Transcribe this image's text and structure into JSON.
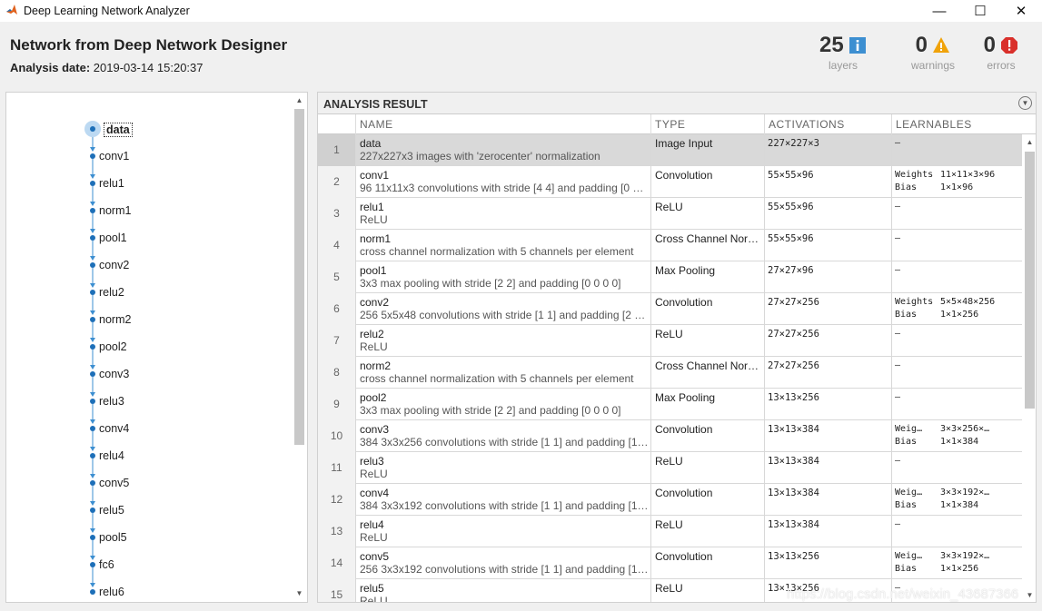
{
  "window": {
    "title": "Deep Learning Network Analyzer",
    "min_label": "—",
    "max_label": "☐",
    "close_label": "✕"
  },
  "header": {
    "title": "Network from Deep Network Designer",
    "analysis_date_label": "Analysis date:",
    "analysis_date_value": "2019-03-14 15:20:37",
    "layers_count": "25",
    "layers_label": "layers",
    "warnings_count": "0",
    "warnings_label": "warnings",
    "errors_count": "0",
    "errors_label": "errors"
  },
  "graph": {
    "nodes": [
      "data",
      "conv1",
      "relu1",
      "norm1",
      "pool1",
      "conv2",
      "relu2",
      "norm2",
      "pool2",
      "conv3",
      "relu3",
      "conv4",
      "relu4",
      "conv5",
      "relu5",
      "pool5",
      "fc6",
      "relu6"
    ],
    "selected": "data"
  },
  "result": {
    "panel_title": "ANALYSIS RESULT",
    "columns": {
      "name": "NAME",
      "type": "TYPE",
      "activations": "ACTIVATIONS",
      "learnables": "LEARNABLES"
    },
    "rows": [
      {
        "idx": "1",
        "name": "data",
        "desc": "227x227x3 images with 'zerocenter' normalization",
        "type": "Image Input",
        "act": "227×227×3",
        "learn": [
          [
            "–",
            ""
          ]
        ]
      },
      {
        "idx": "2",
        "name": "conv1",
        "desc": "96 11x11x3 convolutions with stride [4 4] and padding [0 …",
        "type": "Convolution",
        "act": "55×55×96",
        "learn": [
          [
            "Weights",
            "11×11×3×96"
          ],
          [
            "Bias",
            "1×1×96"
          ]
        ]
      },
      {
        "idx": "3",
        "name": "relu1",
        "desc": "ReLU",
        "type": "ReLU",
        "act": "55×55×96",
        "learn": [
          [
            "–",
            ""
          ]
        ]
      },
      {
        "idx": "4",
        "name": "norm1",
        "desc": "cross channel normalization with 5 channels per element",
        "type": "Cross Channel Nor…",
        "act": "55×55×96",
        "learn": [
          [
            "–",
            ""
          ]
        ]
      },
      {
        "idx": "5",
        "name": "pool1",
        "desc": "3x3 max pooling with stride [2 2] and padding [0 0 0 0]",
        "type": "Max Pooling",
        "act": "27×27×96",
        "learn": [
          [
            "–",
            ""
          ]
        ]
      },
      {
        "idx": "6",
        "name": "conv2",
        "desc": "256 5x5x48 convolutions with stride [1 1] and padding [2 …",
        "type": "Convolution",
        "act": "27×27×256",
        "learn": [
          [
            "Weights",
            "5×5×48×256"
          ],
          [
            "Bias",
            "1×1×256"
          ]
        ]
      },
      {
        "idx": "7",
        "name": "relu2",
        "desc": "ReLU",
        "type": "ReLU",
        "act": "27×27×256",
        "learn": [
          [
            "–",
            ""
          ]
        ]
      },
      {
        "idx": "8",
        "name": "norm2",
        "desc": "cross channel normalization with 5 channels per element",
        "type": "Cross Channel Nor…",
        "act": "27×27×256",
        "learn": [
          [
            "–",
            ""
          ]
        ]
      },
      {
        "idx": "9",
        "name": "pool2",
        "desc": "3x3 max pooling with stride [2 2] and padding [0 0 0 0]",
        "type": "Max Pooling",
        "act": "13×13×256",
        "learn": [
          [
            "–",
            ""
          ]
        ]
      },
      {
        "idx": "10",
        "name": "conv3",
        "desc": "384 3x3x256 convolutions with stride [1 1] and padding [1…",
        "type": "Convolution",
        "act": "13×13×384",
        "learn": [
          [
            "Weig…",
            "3×3×256×…"
          ],
          [
            "Bias",
            "1×1×384"
          ]
        ]
      },
      {
        "idx": "11",
        "name": "relu3",
        "desc": "ReLU",
        "type": "ReLU",
        "act": "13×13×384",
        "learn": [
          [
            "–",
            ""
          ]
        ]
      },
      {
        "idx": "12",
        "name": "conv4",
        "desc": "384 3x3x192 convolutions with stride [1 1] and padding [1…",
        "type": "Convolution",
        "act": "13×13×384",
        "learn": [
          [
            "Weig…",
            "3×3×192×…"
          ],
          [
            "Bias",
            "1×1×384"
          ]
        ]
      },
      {
        "idx": "13",
        "name": "relu4",
        "desc": "ReLU",
        "type": "ReLU",
        "act": "13×13×384",
        "learn": [
          [
            "–",
            ""
          ]
        ]
      },
      {
        "idx": "14",
        "name": "conv5",
        "desc": "256 3x3x192 convolutions with stride [1 1] and padding [1…",
        "type": "Convolution",
        "act": "13×13×256",
        "learn": [
          [
            "Weig…",
            "3×3×192×…"
          ],
          [
            "Bias",
            "1×1×256"
          ]
        ]
      },
      {
        "idx": "15",
        "name": "relu5",
        "desc": "ReLU",
        "type": "ReLU",
        "act": "13×13×256",
        "learn": [
          [
            "–",
            ""
          ]
        ]
      }
    ]
  },
  "watermark": "https://blog.csdn.net/weixin_43687366",
  "colors": {
    "accent": "#3d8fd1",
    "warning": "#f0a30a",
    "error": "#d9302b",
    "selected_row": "#d9d9d9"
  },
  "icons": [
    "matlab-logo-icon",
    "info-icon",
    "warning-icon",
    "error-icon",
    "collapse-icon",
    "scroll-up-icon",
    "scroll-down-icon"
  ]
}
